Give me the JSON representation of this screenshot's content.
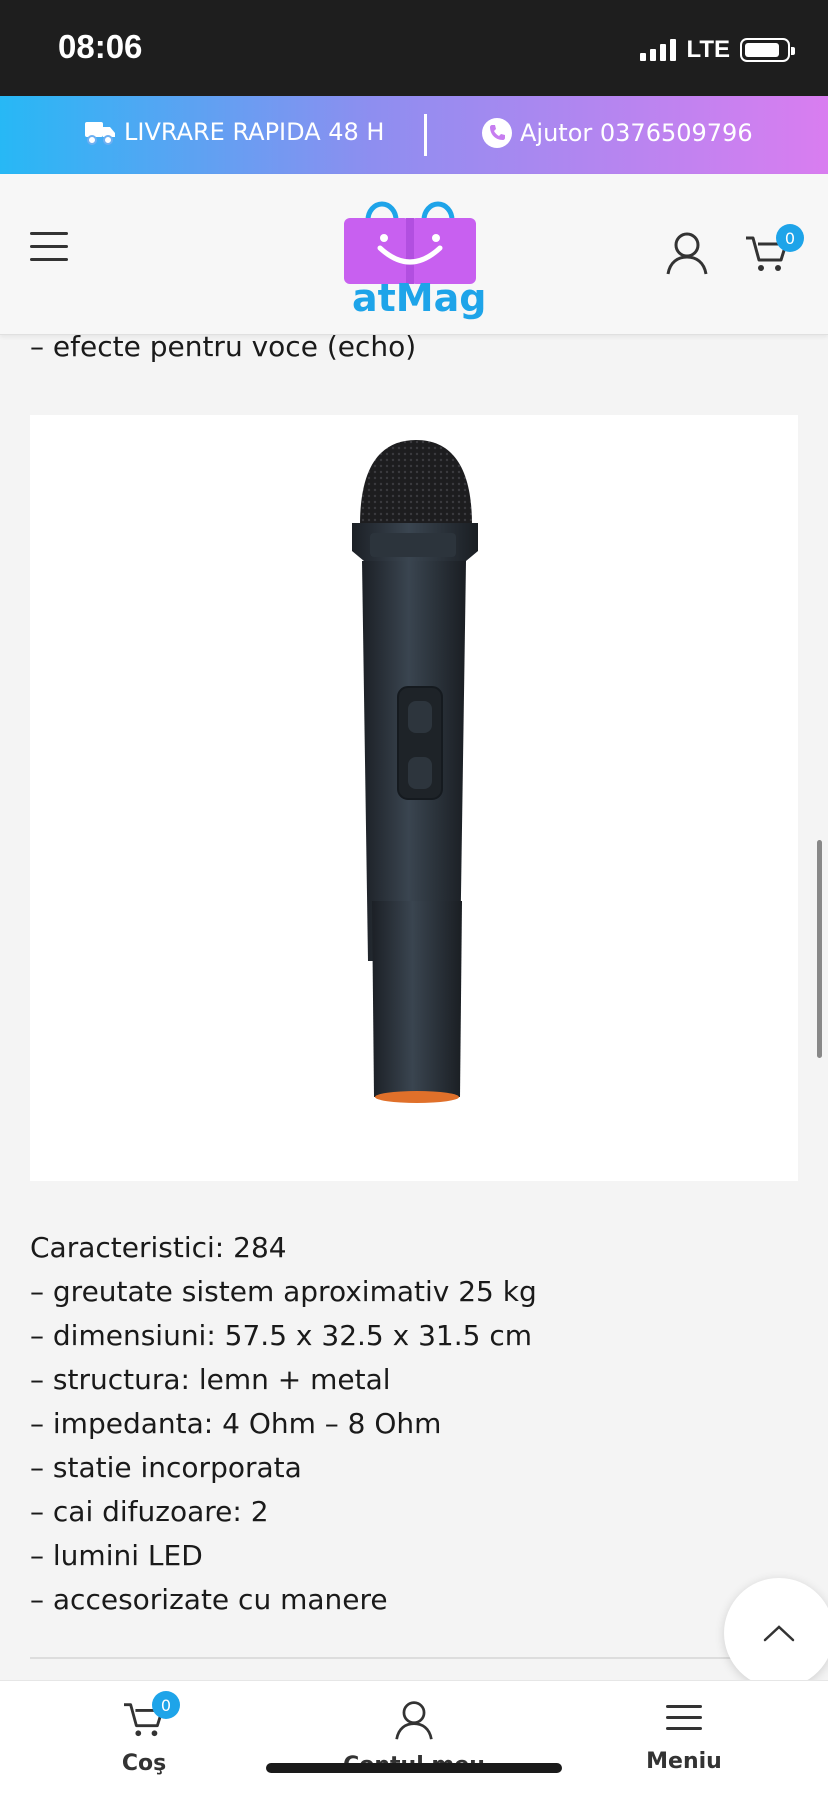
{
  "status_bar": {
    "time": "08:06",
    "network": "LTE"
  },
  "top_bar": {
    "delivery_text": "LIVRARE RAPIDA  48 H",
    "help_text": "Ajutor 0376509796",
    "gradient_start": "#27b8f5",
    "gradient_end": "#d97df0"
  },
  "header": {
    "logo_text": "atMag",
    "cart_count": "0",
    "brand_color": "#1ea4e9",
    "logo_color": "#c860f0"
  },
  "content": {
    "lead_line": "– efecte pentru voce (echo)",
    "image_alt": "wireless microphone",
    "specs": [
      "Caracteristici: 284",
      "– greutate sistem aproximativ 25 kg",
      "– dimensiuni: 57.5 x 32.5 x 31.5 cm",
      "– structura: lemn + metal",
      "– impedanta: 4 Ohm – 8 Ohm",
      "– statie incorporata",
      "– cai difuzoare: 2",
      "– lumini LED",
      "– accesorizate cu manere"
    ]
  },
  "bottom_nav": {
    "cart_label": "Coş",
    "cart_count": "0",
    "account_label": "Contul meu",
    "menu_label": "Meniu"
  }
}
